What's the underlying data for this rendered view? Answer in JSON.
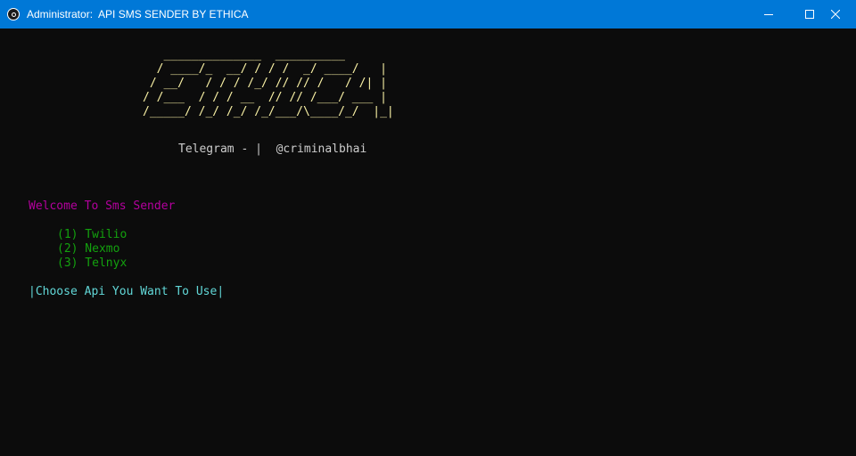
{
  "window": {
    "title": "Administrator:  API SMS SENDER BY ETHICA",
    "icon": "terminal-app-icon",
    "controls": {
      "minimize_icon": "minimize-icon",
      "maximize_icon": "maximize-icon",
      "close_icon": "close-icon"
    },
    "titlebar_color": "#0078d7"
  },
  "console": {
    "background": "#0c0c0c",
    "banner_lines": [
      "   ______________  __________",
      "  / ____/_  __/ / / /  _/ ____/   |",
      " / __/   / / / /_/ // // /   / /| |",
      "/ /___  / / / __  // // /___/ ___ |",
      "/_____/ /_/ /_/ /_/___/\\____/_/  |_|"
    ],
    "telegram_line": "Telegram - |  @criminalbhai",
    "welcome": "Welcome To Sms Sender",
    "options": [
      "(1) Twilio",
      "(2) Nexmo",
      "(3) Telnyx"
    ],
    "prompt": "|Choose Api You Want To Use|",
    "colors": {
      "banner": "#f9f1a5",
      "telegram": "#cccccc",
      "welcome": "#b4009e",
      "options": "#13a10e",
      "prompt": "#61d6d6"
    }
  }
}
